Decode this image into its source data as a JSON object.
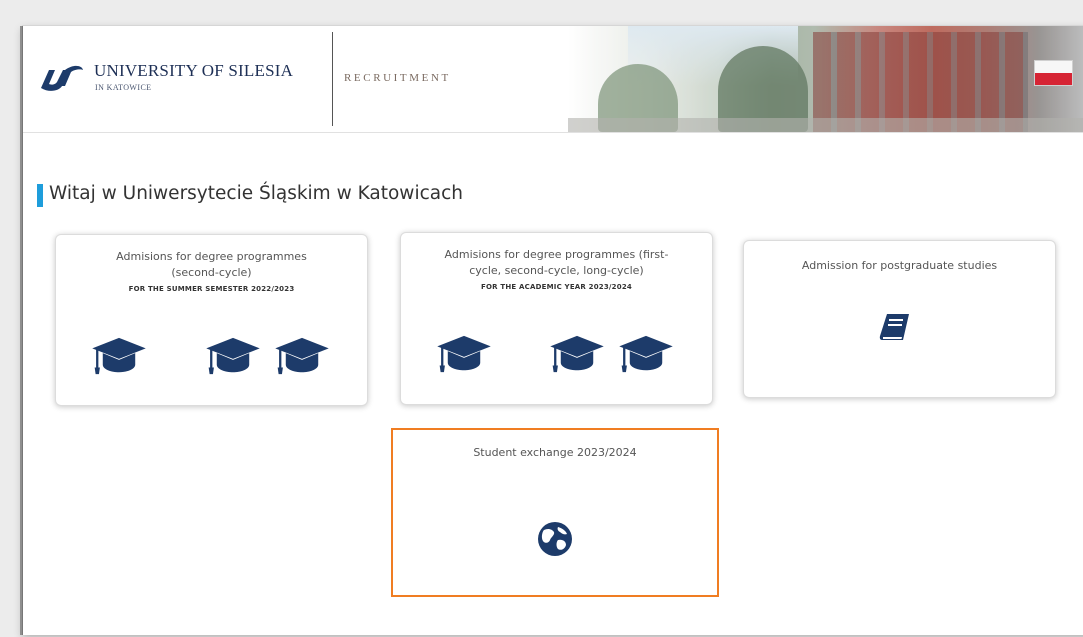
{
  "header": {
    "university_name": "UNIVERSITY OF SILESIA",
    "university_sub": "IN KATOWICE",
    "section_title": "RECRUITMENT",
    "language_flag": "polish-flag"
  },
  "greeting": "Witaj w Uniwersytecie Śląskim w Katowicach",
  "cards": [
    {
      "title_line1": "Admisions for degree programmes",
      "title_line2": "(second-cycle)",
      "subtitle": "FOR THE SUMMER SEMESTER 2022/2023",
      "icon": "graduation-cap-icon"
    },
    {
      "title_line1": "Admisions for degree programmes (first-",
      "title_line2": "cycle, second-cycle, long-cycle)",
      "subtitle": "FOR THE ACADEMIC YEAR 2023/2024",
      "icon": "graduation-cap-icon"
    },
    {
      "title_line1": "Admission for postgraduate studies",
      "icon": "book-icon"
    },
    {
      "title_line1": "Student exchange 2023/2024",
      "icon": "globe-icon"
    }
  ],
  "colors": {
    "brand_navy": "#1d3b6a",
    "accent_blue": "#1e9ddb",
    "highlight_orange": "#f07d22"
  }
}
